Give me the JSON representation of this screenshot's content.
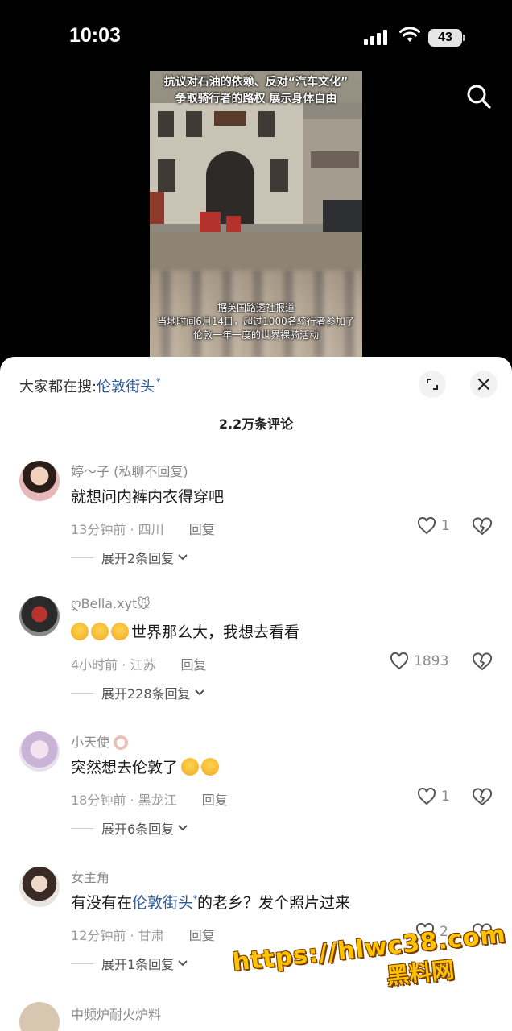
{
  "status_bar": {
    "time": "10:03",
    "battery": "43"
  },
  "video": {
    "caption_top_line1": "抗议对石油的依赖、反对“汽车文化”",
    "caption_top_line2": "争取骑行者的路权 展示身体自由",
    "caption_bottom_line1": "据英国路透社报道",
    "caption_bottom_line2": "当地时间6月14日，超过1000名骑行者参加了",
    "caption_bottom_line3": "伦敦一年一度的世界裸骑活动"
  },
  "sheet": {
    "search_prefix": "大家都在搜:",
    "search_keyword": "伦敦街头",
    "search_suffix_icon": "ᵠ",
    "comment_count": "2.2万条评论"
  },
  "comments": [
    {
      "user": "婷～子 (私聊不回复)",
      "text": "就想问内裤内衣得穿吧",
      "time_location": "13分钟前 · 四川",
      "reply": "回复",
      "likes": "1",
      "expand": "展开2条回复"
    },
    {
      "user": "ღBella.xyt🐭",
      "text": "世界那么大，我想去看看",
      "time_location": "4小时前 · 江苏",
      "reply": "回复",
      "likes": "1893",
      "expand": "展开228条回复"
    },
    {
      "user": "小天使",
      "text": "突然想去伦敦了",
      "time_location": "18分钟前 · 黑龙江",
      "reply": "回复",
      "likes": "1",
      "expand": "展开6条回复"
    },
    {
      "user": "女主角",
      "text_before": "有没有在",
      "text_link": "伦敦街头",
      "text_after": "的老乡？发个照片过来",
      "time_location": "12分钟前 · 甘肃",
      "reply": "回复",
      "likes": "2",
      "expand": "展开1条回复"
    }
  ],
  "partial_comment": {
    "user": "中频炉耐火炉料"
  },
  "watermark": {
    "url": "https://hlwc38.com",
    "name": "黑料网"
  },
  "icons": [
    "search-icon",
    "expand-icon",
    "close-icon",
    "heart-icon",
    "broken-heart-icon",
    "chevron-down-icon"
  ],
  "colors": {
    "link": "#2a5a9a",
    "watermark": "#ffc400"
  }
}
